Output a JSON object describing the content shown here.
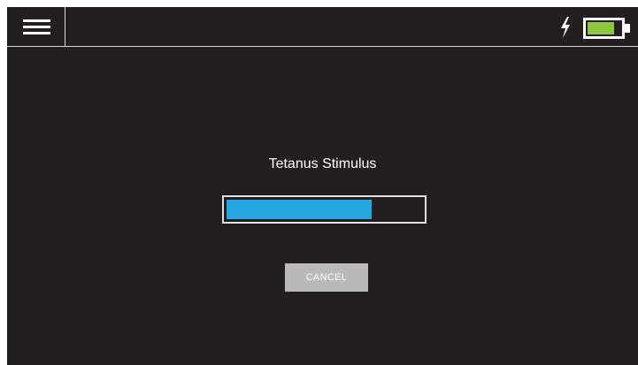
{
  "header": {
    "menu_icon": "hamburger-menu-icon",
    "charging_icon": "lightning-bolt-icon",
    "battery_icon": "battery-icon",
    "battery_level": 0.8,
    "battery_color": "#8dc63f"
  },
  "main": {
    "title": "Tetanus Stimulus",
    "progress": 0.74,
    "progress_color": "#27a7e1",
    "cancel_label": "CANCEL"
  }
}
